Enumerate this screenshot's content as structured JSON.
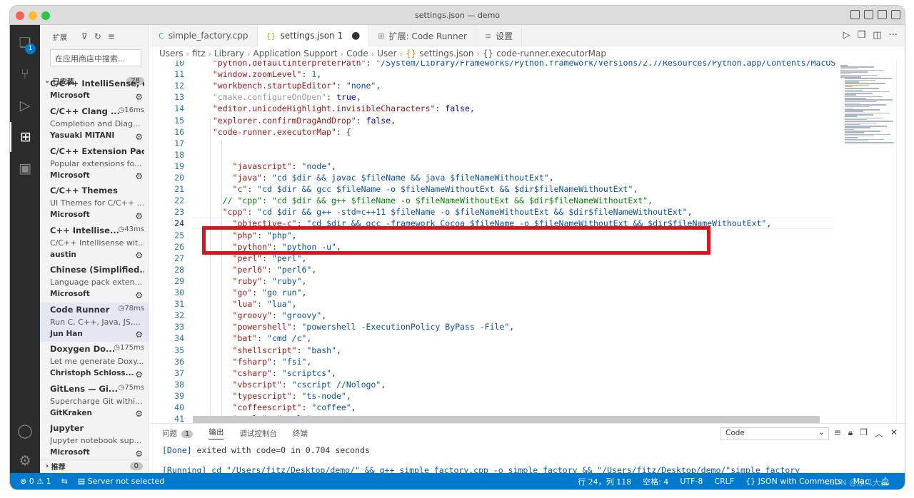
{
  "window": {
    "title": "settings.json — demo"
  },
  "activity": {
    "ext_badge": "1"
  },
  "sidebar": {
    "title": "扩展",
    "search_placeholder": "在应用商店中搜索...",
    "installed_label": "已安装",
    "installed_count": "28",
    "extensions": [
      {
        "name": "C/C++ IntelliSense, d...",
        "ms": "",
        "desc": "",
        "publisher": "Microsoft"
      },
      {
        "name": "C/C++ Clang ...",
        "ms": "16ms",
        "desc": "Completion and Diag...",
        "publisher": "Yasuaki MITANI"
      },
      {
        "name": "C/C++ Extension Pack",
        "ms": "",
        "desc": "Popular extensions fo...",
        "publisher": "Microsoft"
      },
      {
        "name": "C/C++ Themes",
        "ms": "",
        "desc": "UI Themes for C/C++ ...",
        "publisher": "Microsoft"
      },
      {
        "name": "C++ Intellise...",
        "ms": "43ms",
        "desc": "C/C++ Intellisense wit...",
        "publisher": "austin"
      },
      {
        "name": "Chinese (Simplified...",
        "ms": "",
        "desc": "Language pack exten...",
        "publisher": "Microsoft"
      },
      {
        "name": "Code Runner",
        "ms": "78ms",
        "desc": "Run C, C++, Java, JS,...",
        "publisher": "Jun Han"
      },
      {
        "name": "Doxygen Do...",
        "ms": "175ms",
        "desc": "Let me generate Doxy...",
        "publisher": "Christoph Schloss..."
      },
      {
        "name": "GitLens — Gi...",
        "ms": "75ms",
        "desc": "Supercharge Git withi...",
        "publisher": "GitKraken"
      },
      {
        "name": "Jupyter",
        "ms": "",
        "desc": "Jupyter notebook sup...",
        "publisher": "Microsoft"
      }
    ],
    "recommended_label": "推荐",
    "recommended_count": "0"
  },
  "tabs": [
    {
      "label": "simple_factory.cpp",
      "icon": "C"
    },
    {
      "label": "settings.json 1",
      "icon": "{}"
    },
    {
      "label": "扩展: Code Runner",
      "icon": "⊞"
    },
    {
      "label": "设置",
      "icon": "≡"
    }
  ],
  "breadcrumb": [
    "Users",
    "fitz",
    "Library",
    "Application Support",
    "Code",
    "User",
    "settings.json",
    "code-runner.executorMap"
  ],
  "breadcrumb_file_icon": "{}",
  "code_lines": [
    {
      "n": "10",
      "text": "  \"python.defaultInterpreterPath\": \"/System/Library/Frameworks/Python.framework/Versions/2.7/Resources/Python.app/Contents/MacOS/Python\","
    },
    {
      "n": "11",
      "text": "  \"window.zoomLevel\": 1,"
    },
    {
      "n": "12",
      "text": "  \"workbench.startupEditor\": \"none\","
    },
    {
      "n": "13",
      "text": "  \"cmake.configureOnOpen\": true,"
    },
    {
      "n": "14",
      "text": "  \"editor.unicodeHighlight.invisibleCharacters\": false,"
    },
    {
      "n": "15",
      "text": "  \"explorer.confirmDragAndDrop\": false,"
    },
    {
      "n": "16",
      "text": "  \"code-runner.executorMap\": {"
    },
    {
      "n": "17",
      "text": ""
    },
    {
      "n": "18",
      "text": ""
    },
    {
      "n": "19",
      "text": "      \"javascript\": \"node\","
    },
    {
      "n": "20",
      "text": "      \"java\": \"cd $dir && javac $fileName && java $fileNameWithoutExt\","
    },
    {
      "n": "21",
      "text": "      \"c\": \"cd $dir && gcc $fileName -o $fileNameWithoutExt && $dir$fileNameWithoutExt\","
    },
    {
      "n": "22",
      "text": "    // \"cpp\": \"cd $dir && g++ $fileName -o $fileNameWithoutExt && $dir$fileNameWithoutExt\","
    },
    {
      "n": "23",
      "text": "    \"cpp\": \"cd $dir && g++ -std=c++11 $fileName -o $fileNameWithoutExt && $dir$fileNameWithoutExt\","
    },
    {
      "n": "24",
      "text": "      \"objective-c\": \"cd $dir && gcc -framework Cocoa $fileName -o $fileNameWithoutExt && $dir$fileNameWithoutExt\","
    },
    {
      "n": "25",
      "text": "      \"php\": \"php\","
    },
    {
      "n": "26",
      "text": "      \"python\": \"python -u\","
    },
    {
      "n": "27",
      "text": "      \"perl\": \"perl\","
    },
    {
      "n": "28",
      "text": "      \"perl6\": \"perl6\","
    },
    {
      "n": "29",
      "text": "      \"ruby\": \"ruby\","
    },
    {
      "n": "30",
      "text": "      \"go\": \"go run\","
    },
    {
      "n": "31",
      "text": "      \"lua\": \"lua\","
    },
    {
      "n": "32",
      "text": "      \"groovy\": \"groovy\","
    },
    {
      "n": "33",
      "text": "      \"powershell\": \"powershell -ExecutionPolicy ByPass -File\","
    },
    {
      "n": "34",
      "text": "      \"bat\": \"cmd /c\","
    },
    {
      "n": "35",
      "text": "      \"shellscript\": \"bash\","
    },
    {
      "n": "36",
      "text": "      \"fsharp\": \"fsi\","
    },
    {
      "n": "37",
      "text": "      \"csharp\": \"scriptcs\","
    },
    {
      "n": "38",
      "text": "      \"vbscript\": \"cscript //Nologo\","
    },
    {
      "n": "39",
      "text": "      \"typescript\": \"ts-node\","
    },
    {
      "n": "40",
      "text": "      \"coffeescript\": \"coffee\","
    },
    {
      "n": "41",
      "text": "      \"scala\": \"scala\","
    }
  ],
  "current_line": "24",
  "panel": {
    "tabs": [
      "问题",
      "输出",
      "调试控制台",
      "终端"
    ],
    "problems_count": "1",
    "active_tab": "输出",
    "channel": "Code",
    "output_line1_tag": "[Done]",
    "output_line1_text": " exited with code=0 in 0.704 seconds",
    "output_line2": "[Running] cd \"/Users/fitz/Desktop/demo/\" && g++ simple_factory.cpp -o simple_factory && \"/Users/fitz/Desktop/demo/\"simple_factory"
  },
  "status": {
    "errors": "⊗ 0",
    "warnings": "⚠ 1",
    "server": "Server not selected",
    "position": "行 24，列 118",
    "spaces": "空格: 4",
    "encoding": "UTF-8",
    "eol": "CRLF",
    "language": "JSON with Comments",
    "platform": "Mac"
  },
  "watermark": "CSDN @凉瓜大叔"
}
